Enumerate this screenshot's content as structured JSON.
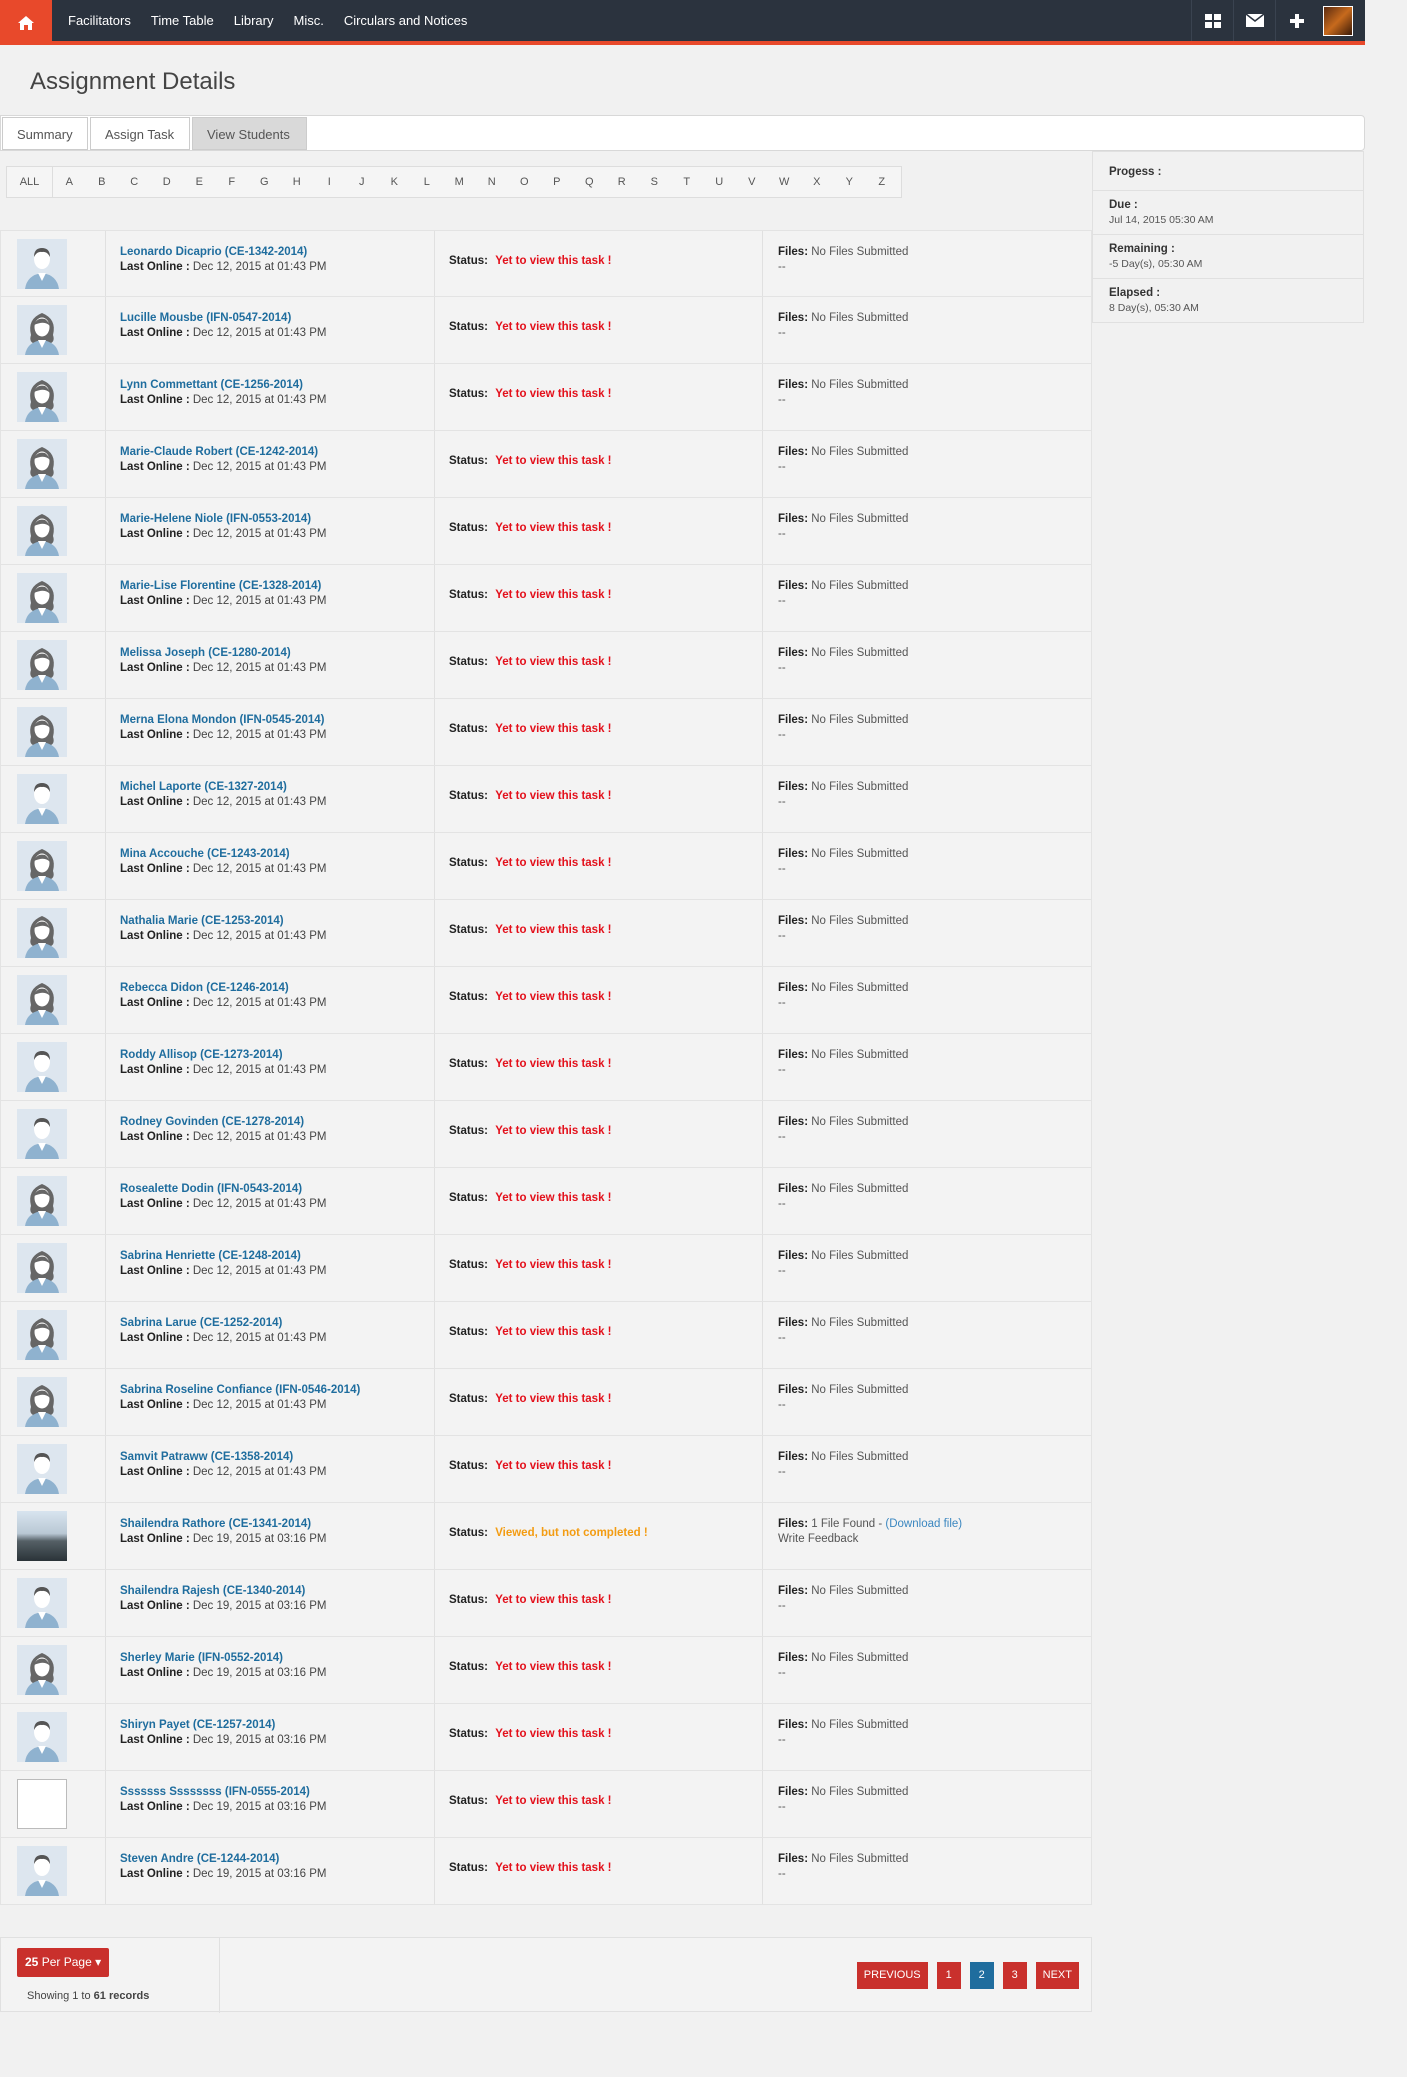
{
  "nav": {
    "home_icon": "home-icon",
    "items": [
      "Facilitators",
      "Time Table",
      "Library",
      "Misc.",
      "Circulars and Notices"
    ],
    "right_icons": [
      "grid-icon",
      "envelope-icon",
      "plus-icon"
    ]
  },
  "page_title": "Assignment Details",
  "tabs": [
    "Summary",
    "Assign Task",
    "View Students"
  ],
  "alphabet": [
    "ALL",
    "A",
    "B",
    "C",
    "D",
    "E",
    "F",
    "G",
    "H",
    "I",
    "J",
    "K",
    "L",
    "M",
    "N",
    "O",
    "P",
    "Q",
    "R",
    "S",
    "T",
    "U",
    "V",
    "W",
    "X",
    "Y",
    "Z"
  ],
  "labels": {
    "last_online": "Last Online :",
    "status": "Status:",
    "files": "Files:"
  },
  "students": [
    {
      "name": "Leonardo Dicaprio (CE-1342-2014)",
      "last": "Dec 12, 2015 at 01:43 PM",
      "status": "Yet to view this task !",
      "status_type": "red",
      "files": "No Files Submitted",
      "sub": "--",
      "avatar": "male"
    },
    {
      "name": "Lucille Mousbe (IFN-0547-2014)",
      "last": "Dec 12, 2015 at 01:43 PM",
      "status": "Yet to view this task !",
      "status_type": "red",
      "files": "No Files Submitted",
      "sub": "--",
      "avatar": "female"
    },
    {
      "name": "Lynn Commettant (CE-1256-2014)",
      "last": "Dec 12, 2015 at 01:43 PM",
      "status": "Yet to view this task !",
      "status_type": "red",
      "files": "No Files Submitted",
      "sub": "--",
      "avatar": "female"
    },
    {
      "name": "Marie-Claude Robert (CE-1242-2014)",
      "last": "Dec 12, 2015 at 01:43 PM",
      "status": "Yet to view this task !",
      "status_type": "red",
      "files": "No Files Submitted",
      "sub": "--",
      "avatar": "female"
    },
    {
      "name": "Marie-Helene Niole (IFN-0553-2014)",
      "last": "Dec 12, 2015 at 01:43 PM",
      "status": "Yet to view this task !",
      "status_type": "red",
      "files": "No Files Submitted",
      "sub": "--",
      "avatar": "female"
    },
    {
      "name": "Marie-Lise Florentine (CE-1328-2014)",
      "last": "Dec 12, 2015 at 01:43 PM",
      "status": "Yet to view this task !",
      "status_type": "red",
      "files": "No Files Submitted",
      "sub": "--",
      "avatar": "female"
    },
    {
      "name": "Melissa Joseph (CE-1280-2014)",
      "last": "Dec 12, 2015 at 01:43 PM",
      "status": "Yet to view this task !",
      "status_type": "red",
      "files": "No Files Submitted",
      "sub": "--",
      "avatar": "female"
    },
    {
      "name": "Merna Elona Mondon (IFN-0545-2014)",
      "last": "Dec 12, 2015 at 01:43 PM",
      "status": "Yet to view this task !",
      "status_type": "red",
      "files": "No Files Submitted",
      "sub": "--",
      "avatar": "female"
    },
    {
      "name": "Michel Laporte (CE-1327-2014)",
      "last": "Dec 12, 2015 at 01:43 PM",
      "status": "Yet to view this task !",
      "status_type": "red",
      "files": "No Files Submitted",
      "sub": "--",
      "avatar": "male"
    },
    {
      "name": "Mina Accouche (CE-1243-2014)",
      "last": "Dec 12, 2015 at 01:43 PM",
      "status": "Yet to view this task !",
      "status_type": "red",
      "files": "No Files Submitted",
      "sub": "--",
      "avatar": "female"
    },
    {
      "name": "Nathalia Marie (CE-1253-2014)",
      "last": "Dec 12, 2015 at 01:43 PM",
      "status": "Yet to view this task !",
      "status_type": "red",
      "files": "No Files Submitted",
      "sub": "--",
      "avatar": "female"
    },
    {
      "name": "Rebecca Didon (CE-1246-2014)",
      "last": "Dec 12, 2015 at 01:43 PM",
      "status": "Yet to view this task !",
      "status_type": "red",
      "files": "No Files Submitted",
      "sub": "--",
      "avatar": "female"
    },
    {
      "name": "Roddy Allisop (CE-1273-2014)",
      "last": "Dec 12, 2015 at 01:43 PM",
      "status": "Yet to view this task !",
      "status_type": "red",
      "files": "No Files Submitted",
      "sub": "--",
      "avatar": "male"
    },
    {
      "name": "Rodney Govinden (CE-1278-2014)",
      "last": "Dec 12, 2015 at 01:43 PM",
      "status": "Yet to view this task !",
      "status_type": "red",
      "files": "No Files Submitted",
      "sub": "--",
      "avatar": "male"
    },
    {
      "name": "Rosealette Dodin (IFN-0543-2014)",
      "last": "Dec 12, 2015 at 01:43 PM",
      "status": "Yet to view this task !",
      "status_type": "red",
      "files": "No Files Submitted",
      "sub": "--",
      "avatar": "female"
    },
    {
      "name": "Sabrina Henriette (CE-1248-2014)",
      "last": "Dec 12, 2015 at 01:43 PM",
      "status": "Yet to view this task !",
      "status_type": "red",
      "files": "No Files Submitted",
      "sub": "--",
      "avatar": "female"
    },
    {
      "name": "Sabrina Larue (CE-1252-2014)",
      "last": "Dec 12, 2015 at 01:43 PM",
      "status": "Yet to view this task !",
      "status_type": "red",
      "files": "No Files Submitted",
      "sub": "--",
      "avatar": "female"
    },
    {
      "name": "Sabrina Roseline Confiance (IFN-0546-2014)",
      "last": "Dec 12, 2015 at 01:43 PM",
      "status": "Yet to view this task !",
      "status_type": "red",
      "files": "No Files Submitted",
      "sub": "--",
      "avatar": "female"
    },
    {
      "name": "Samvit Patraww (CE-1358-2014)",
      "last": "Dec 12, 2015 at 01:43 PM",
      "status": "Yet to view this task !",
      "status_type": "red",
      "files": "No Files Submitted",
      "sub": "--",
      "avatar": "male"
    },
    {
      "name": "Shailendra Rathore (CE-1341-2014)",
      "last": "Dec 19, 2015 at 03:16 PM",
      "status": "Viewed, but not completed !",
      "status_type": "orange",
      "files": "1 File Found - ",
      "files_link": "(Download file)",
      "sub": "Write Feedback",
      "avatar": "photo"
    },
    {
      "name": "Shailendra Rajesh (CE-1340-2014)",
      "last": "Dec 19, 2015 at 03:16 PM",
      "status": "Yet to view this task !",
      "status_type": "red",
      "files": "No Files Submitted",
      "sub": "--",
      "avatar": "male"
    },
    {
      "name": "Sherley Marie (IFN-0552-2014)",
      "last": "Dec 19, 2015 at 03:16 PM",
      "status": "Yet to view this task !",
      "status_type": "red",
      "files": "No Files Submitted",
      "sub": "--",
      "avatar": "female"
    },
    {
      "name": "Shiryn Payet (CE-1257-2014)",
      "last": "Dec 19, 2015 at 03:16 PM",
      "status": "Yet to view this task !",
      "status_type": "red",
      "files": "No Files Submitted",
      "sub": "--",
      "avatar": "male"
    },
    {
      "name": "Sssssss Ssssssss (IFN-0555-2014)",
      "last": "Dec 19, 2015 at 03:16 PM",
      "status": "Yet to view this task !",
      "status_type": "red",
      "files": "No Files Submitted",
      "sub": "--",
      "avatar": "broken"
    },
    {
      "name": "Steven Andre (CE-1244-2014)",
      "last": "Dec 19, 2015 at 03:16 PM",
      "status": "Yet to view this task !",
      "status_type": "red",
      "files": "No Files Submitted",
      "sub": "--",
      "avatar": "male"
    }
  ],
  "side": {
    "progress_label": "Progess :",
    "due_label": "Due :",
    "due_value": "Jul 14, 2015 05:30 AM",
    "remaining_label": "Remaining :",
    "remaining_value": "-5 Day(s), 05:30 AM",
    "elapsed_label": "Elapsed :",
    "elapsed_value": "8 Day(s), 05:30 AM"
  },
  "footer": {
    "per_page_num": "25",
    "per_page_text": "Per Page",
    "showing_prefix": "Showing 1 to",
    "showing_total": "61 records",
    "prev": "PREVIOUS",
    "pages": [
      "1",
      "2",
      "3"
    ],
    "current_page": "2",
    "next": "NEXT"
  },
  "colors": {
    "accent": "#e8492b",
    "topbar": "#2b333e",
    "link": "#1f6d9e",
    "status_red": "#e3101b",
    "status_orange": "#f39c12",
    "pager_red": "#c9302c",
    "pager_current": "#1f6d9e"
  }
}
